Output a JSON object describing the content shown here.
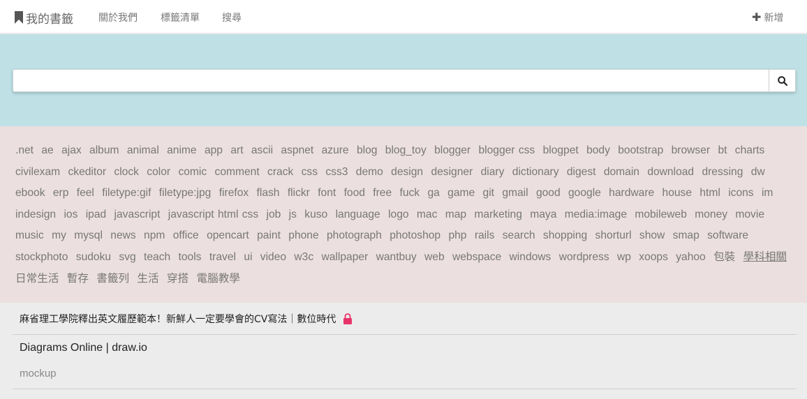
{
  "navbar": {
    "brand": "我的書籤",
    "links": [
      "關於我們",
      "標籤清單",
      "搜尋"
    ],
    "add_label": "新增"
  },
  "search": {
    "value": "",
    "placeholder": ""
  },
  "tags": [
    ".net",
    "ae",
    "ajax",
    "album",
    "animal",
    "anime",
    "app",
    "art",
    "ascii",
    "aspnet",
    "azure",
    "blog",
    "blog_toy",
    "blogger",
    "blogger css",
    "blogpet",
    "body",
    "bootstrap",
    "browser",
    "bt",
    "charts",
    "civilexam",
    "ckeditor",
    "clock",
    "color",
    "comic",
    "comment",
    "crack",
    "css",
    "css3",
    "demo",
    "design",
    "designer",
    "diary",
    "dictionary",
    "digest",
    "domain",
    "download",
    "dressing",
    "dw",
    "ebook",
    "erp",
    "feel",
    "filetype:gif",
    "filetype:jpg",
    "firefox",
    "flash",
    "flickr",
    "font",
    "food",
    "free",
    "fuck",
    "ga",
    "game",
    "git",
    "gmail",
    "good",
    "google",
    "hardware",
    "house",
    "html",
    "icons",
    "im",
    "indesign",
    "ios",
    "ipad",
    "javascript",
    "javascript html css",
    "job",
    "js",
    "kuso",
    "language",
    "logo",
    "mac",
    "map",
    "marketing",
    "maya",
    "media:image",
    "mobileweb",
    "money",
    "movie",
    "music",
    "my",
    "mysql",
    "news",
    "npm",
    "office",
    "opencart",
    "paint",
    "phone",
    "photograph",
    "photoshop",
    "php",
    "rails",
    "search",
    "shopping",
    "shorturl",
    "show",
    "smap",
    "software",
    "stockphoto",
    "sudoku",
    "svg",
    "teach",
    "tools",
    "travel",
    "ui",
    "video",
    "w3c",
    "wallpaper",
    "wantbuy",
    "web",
    "webspace",
    "windows",
    "wordpress",
    "wp",
    "xoops",
    "yahoo",
    "包裝",
    "學科相關",
    "日常生活",
    "暫存",
    "書籤列",
    "生活",
    "穿搭",
    "電腦教學"
  ],
  "underlined_tag": "學科相關",
  "bookmarks": [
    {
      "title": "麻省理工學院釋出英文履歷範本！新鮮人一定要學會的CV寫法｜數位時代",
      "private": true
    },
    {
      "title": "Diagrams Online | draw.io",
      "tag": "mockup"
    }
  ],
  "colors": {
    "hero_bg": "#bfe1e6",
    "tags_bg": "#ecdfdf",
    "lock": "#e8336a"
  }
}
